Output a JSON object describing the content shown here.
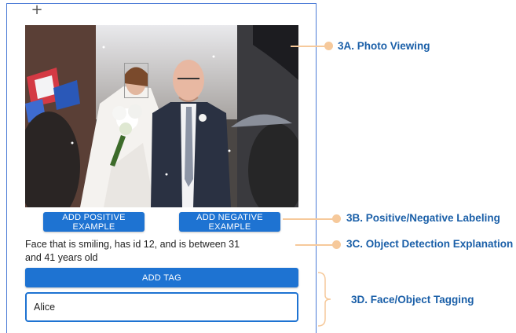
{
  "toolbar": {
    "add_icon": "plus-icon"
  },
  "photo": {
    "face_highlight": "face-bounding-box"
  },
  "buttons": {
    "positive_label": "ADD POSITIVE EXAMPLE",
    "negative_label": "ADD NEGATIVE EXAMPLE",
    "tag_label": "ADD TAG"
  },
  "explanation": {
    "text": "Face that is smiling, has id 12, and is between 31 and 41 years old"
  },
  "tag_input": {
    "value": "Alice"
  },
  "annotations": [
    {
      "num": "3a",
      "label": "3A. Photo Viewing"
    },
    {
      "num": "3b",
      "label": "3B. Positive/Negative Labeling"
    },
    {
      "num": "3c",
      "label": "3C. Object Detection Explanation"
    },
    {
      "num": "3d",
      "label": "3D. Face/Object Tagging"
    }
  ],
  "colors": {
    "primary": "#1e73d2",
    "annotation_text": "#1a5fa8",
    "annotation_connector": "#f6c99b",
    "frame": "#4a7ad6"
  }
}
